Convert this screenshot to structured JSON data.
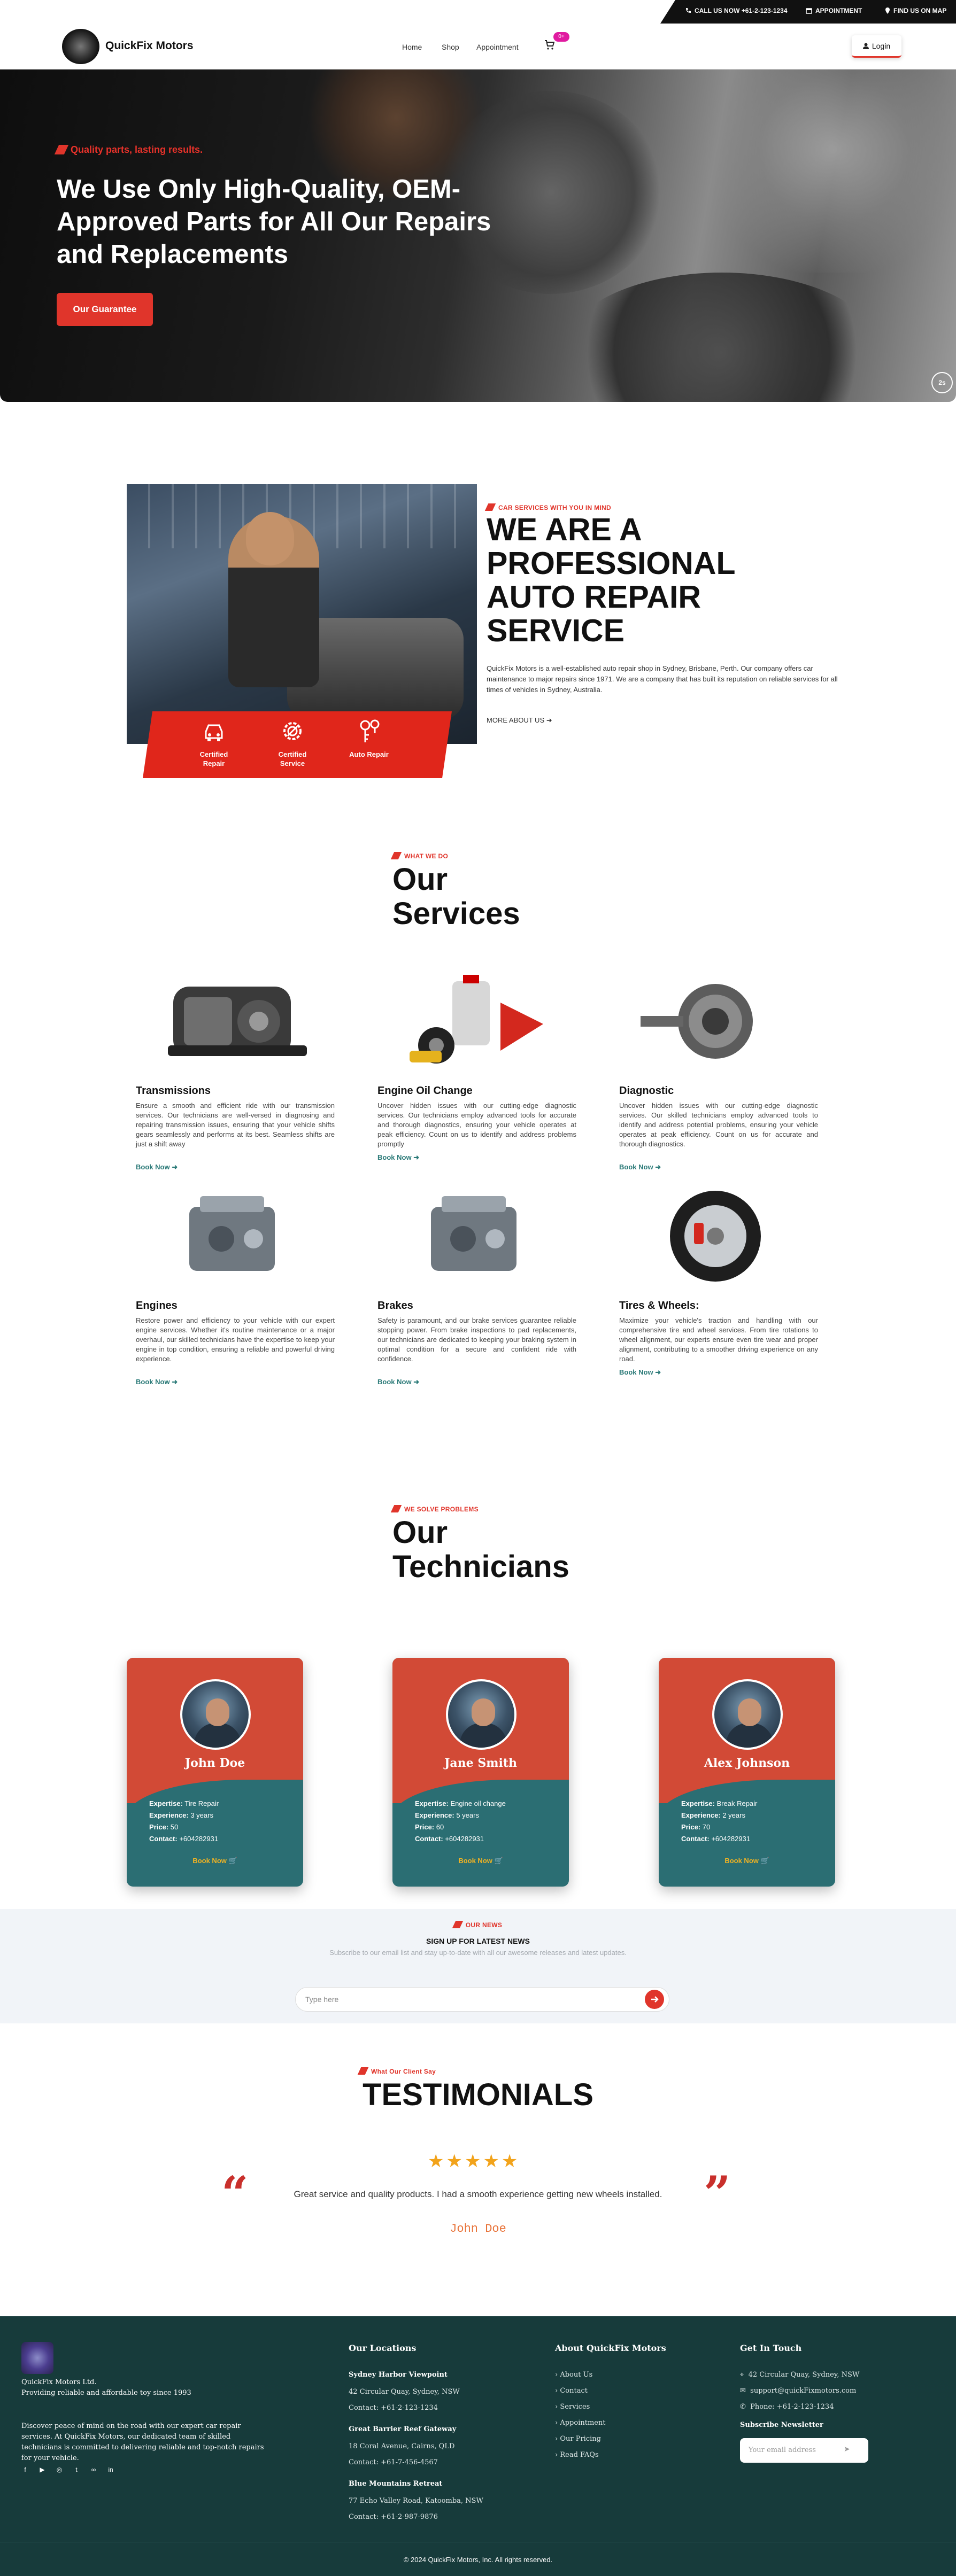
{
  "topbar": {
    "call": "CALL US NOW +61-2-123-1234",
    "appointment": "APPOINTMENT",
    "find": "FIND US ON MAP"
  },
  "header": {
    "brand": "QuickFix Motors",
    "nav": [
      "Home",
      "Shop",
      "Appointment"
    ],
    "cart_badge": "0+",
    "login": "Login"
  },
  "hero": {
    "tag": "Quality parts, lasting results.",
    "title": "We Use Only High-Quality, OEM-Approved Parts for All Our Repairs and Replacements",
    "button": "Our Guarantee",
    "slide_label": "2s"
  },
  "about": {
    "badges": [
      "Certified Repair",
      "Certified Service",
      "Auto Repair"
    ],
    "tag": "CAR SERVICES WITH YOU IN MIND",
    "heading": "WE ARE A PROFESSIONAL AUTO REPAIR SERVICE",
    "text": "QuickFix Motors is a well-established auto repair shop in Sydney, Brisbane, Perth. Our company offers car maintenance to major repairs since 1971. We are a company that has built its reputation on reliable services for all times of vehicles in Sydney, Australia.",
    "more": "MORE ABOUT US"
  },
  "services": {
    "tag": "WHAT WE DO",
    "heading": "Our Services",
    "book": "Book Now",
    "items": [
      {
        "title": "Transmissions",
        "text": "Ensure a smooth and efficient ride with our transmission services. Our technicians are well-versed in diagnosing and repairing transmission issues, ensuring that your vehicle shifts gears seamlessly and performs at its best. Seamless shifts are just a shift away"
      },
      {
        "title": "Engine Oil Change",
        "text": "Uncover hidden issues with our cutting-edge diagnostic services. Our technicians employ advanced tools for accurate and thorough diagnostics, ensuring your vehicle operates at peak efficiency. Count on us to identify and address problems promptly"
      },
      {
        "title": "Diagnostic",
        "text": "Uncover hidden issues with our cutting-edge diagnostic services. Our skilled technicians employ advanced tools to identify and address potential problems, ensuring your vehicle operates at peak efficiency. Count on us for accurate and thorough diagnostics."
      },
      {
        "title": "Engines",
        "text": "Restore power and efficiency to your vehicle with our expert engine services. Whether it's routine maintenance or a major overhaul, our skilled technicians have the expertise to keep your engine in top condition, ensuring a reliable and powerful driving experience."
      },
      {
        "title": "Brakes",
        "text": "Safety is paramount, and our brake services guarantee reliable stopping power. From brake inspections to pad replacements, our technicians are dedicated to keeping your braking system in optimal condition for a secure and confident ride with confidence."
      },
      {
        "title": "Tires & Wheels:",
        "text": "Maximize your vehicle's traction and handling with our comprehensive tire and wheel services. From tire rotations to wheel alignment, our experts ensure even tire wear and proper alignment, contributing to a smoother driving experience on any road."
      }
    ]
  },
  "technicians": {
    "tag": "WE SOLVE PROBLEMS",
    "heading": "Our Technicians",
    "labels": {
      "expertise": "Expertise:",
      "experience": "Experience:",
      "price": "Price:",
      "contact": "Contact:"
    },
    "book": "Book Now",
    "items": [
      {
        "name": "John Doe",
        "expertise": "Tire Repair",
        "experience": "3 years",
        "price": "50",
        "contact": "+604282931"
      },
      {
        "name": "Jane Smith",
        "expertise": "Engine oil change",
        "experience": "5 years",
        "price": "60",
        "contact": "+604282931"
      },
      {
        "name": "Alex Johnson",
        "expertise": "Break Repair",
        "experience": "2 years",
        "price": "70",
        "contact": "+604282931"
      }
    ]
  },
  "newsletter": {
    "tag": "OUR NEWS",
    "heading": "SIGN UP FOR LATEST NEWS",
    "text": "Subscribe to our email list and stay up-to-date with all our awesome releases and latest updates.",
    "placeholder": "Type here"
  },
  "testimonials": {
    "tag": "What Our Client Say",
    "heading": "TESTIMONIALS",
    "rating": 5,
    "quote": "Great service and quality products. I had a smooth experience getting new wheels installed.",
    "author": "John Doe"
  },
  "footer": {
    "company": "QuickFix Motors Ltd.",
    "tagline": "Providing reliable and affordable toy since 1993",
    "about_text": "Discover peace of mind on the road with our expert car repair services. At QuickFix Motors, our dedicated team of skilled technicians is committed to delivering reliable and top-notch repairs for your vehicle.",
    "locations_title": "Our Locations",
    "locations": [
      {
        "name": "Sydney Harbor Viewpoint",
        "address": "42 Circular Quay, Sydney, NSW",
        "contact": "Contact: +61-2-123-1234"
      },
      {
        "name": "Great Barrier Reef Gateway",
        "address": "18 Coral Avenue, Cairns, QLD",
        "contact": "Contact: +61-7-456-4567"
      },
      {
        "name": "Blue Mountains Retreat",
        "address": "77 Echo Valley Road, Katoomba, NSW",
        "contact": "Contact: +61-2-987-9876"
      }
    ],
    "about_title": "About QuickFix Motors",
    "links": [
      "About Us",
      "Contact",
      "Services",
      "Appointment",
      "Our Pricing",
      "Read FAQs"
    ],
    "contact_title": "Get In Touch",
    "contact": {
      "address": "42 Circular Quay, Sydney, NSW",
      "email": "support@quickFixmotors.com",
      "phone": "Phone: +61-2-123-1234"
    },
    "newsletter_title": "Subscribe Newsletter",
    "email_placeholder": "Your email address",
    "copyright": "© 2024 QuickFix Motors, Inc. All rights reserved."
  },
  "colors": {
    "accent": "#e0352b",
    "teal": "#2b6e73",
    "footer": "#173b3b",
    "star": "#f2a31b"
  }
}
